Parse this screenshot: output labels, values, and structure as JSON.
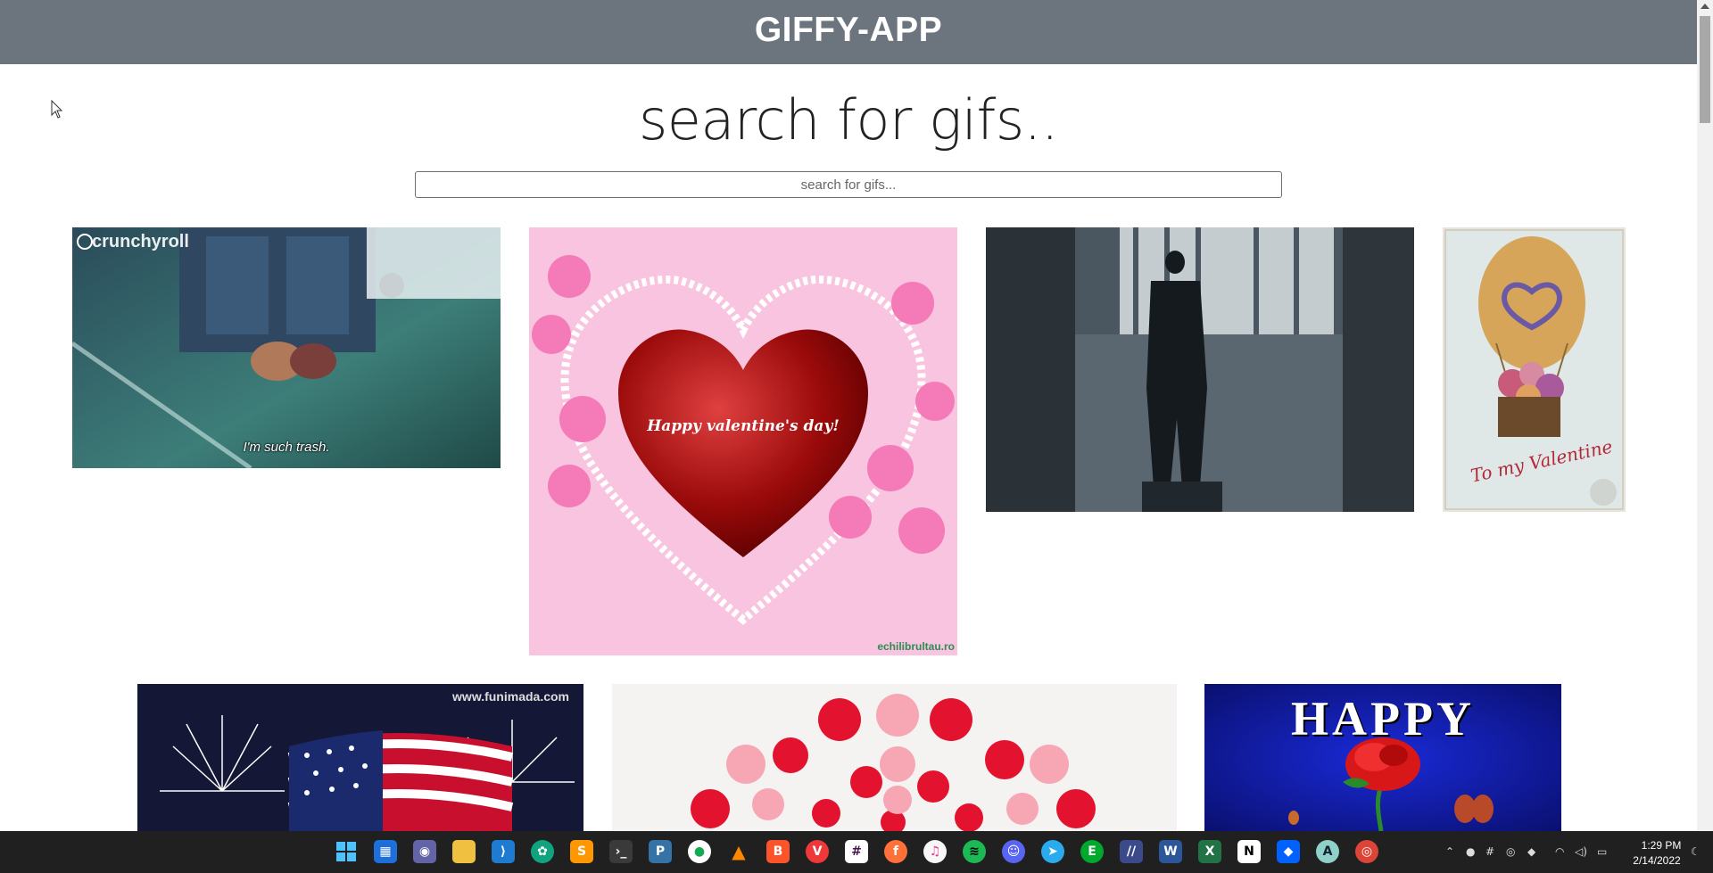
{
  "app": {
    "title": "GIFFY-APP"
  },
  "main": {
    "heading": "search for gifs.."
  },
  "search": {
    "placeholder": "search for gifs..."
  },
  "gifs": [
    {
      "id": "crunchyroll",
      "watermark": "crunchyroll",
      "caption": "I'm such trash."
    },
    {
      "id": "valentine-heart",
      "caption": "Happy valentine's day!",
      "watermark": "echilibrultau.ro"
    },
    {
      "id": "silhouette-walk"
    },
    {
      "id": "vintage-balloon",
      "caption": "To my Valentine"
    },
    {
      "id": "fireworks-flag",
      "watermark": "www.funimada.com"
    },
    {
      "id": "hearts-fan"
    },
    {
      "id": "happy-rose",
      "caption": "HAPPY"
    }
  ],
  "colors": {
    "header_bg": "#6c757d",
    "taskbar_bg": "#202020"
  },
  "taskbar": {
    "icons": [
      "windows-start-icon",
      "widgets-icon",
      "teams-chat-icon",
      "file-explorer-icon",
      "vscode-icon",
      "chatgpt-icon",
      "sublime-text-icon",
      "terminal-icon",
      "python-icon",
      "mongodb-icon",
      "vlc-icon",
      "brave-icon",
      "vivaldi-icon",
      "slack-icon",
      "firefox-icon",
      "itunes-icon",
      "spotify-icon",
      "discord-icon",
      "telegram-icon",
      "evernote-icon",
      "typora-icon",
      "word-icon",
      "excel-icon",
      "notion-icon",
      "dropbox-icon",
      "arc-icon",
      "chrome-icon"
    ],
    "clock": {
      "time": "1:29 PM",
      "date": "2/14/2022"
    }
  }
}
